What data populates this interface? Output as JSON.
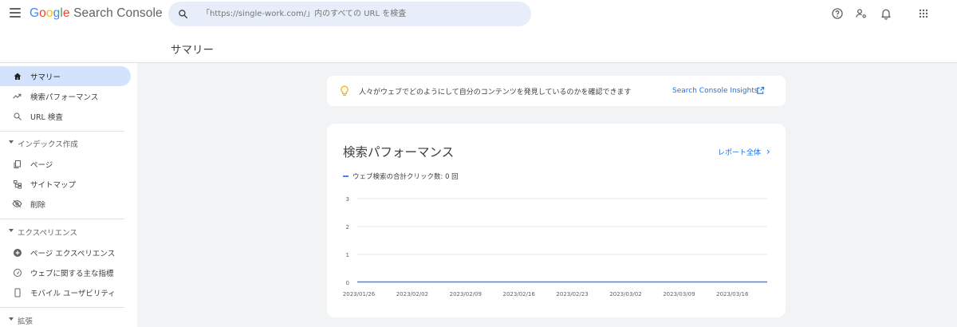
{
  "header": {
    "logo": {
      "g": "G",
      "o1": "o",
      "o2": "o",
      "g2": "g",
      "l": "l",
      "e": "e",
      "product": "Search Console"
    },
    "search_placeholder": "「https://single-work.com/」内のすべての URL を検査",
    "icons": [
      "menu-icon",
      "search-icon",
      "help-icon",
      "manage-users-icon",
      "notifications-icon",
      "apps-icon"
    ]
  },
  "page_title": "サマリー",
  "sidebar": {
    "items": [
      {
        "label": "サマリー",
        "icon": "home-icon",
        "active": true
      },
      {
        "label": "検索パフォーマンス",
        "icon": "trending-icon"
      },
      {
        "label": "URL 検査",
        "icon": "search-icon"
      }
    ],
    "sections": [
      {
        "label": "インデックス作成",
        "items": [
          {
            "label": "ページ",
            "icon": "pages-icon"
          },
          {
            "label": "サイトマップ",
            "icon": "sitemap-icon"
          },
          {
            "label": "削除",
            "icon": "removals-icon"
          }
        ]
      },
      {
        "label": "エクスペリエンス",
        "items": [
          {
            "label": "ページ エクスペリエンス",
            "icon": "page-experience-icon"
          },
          {
            "label": "ウェブに関する主な指標",
            "icon": "speed-icon"
          },
          {
            "label": "モバイル ユーザビリティ",
            "icon": "mobile-icon"
          }
        ]
      },
      {
        "label": "拡張",
        "items": []
      }
    ]
  },
  "insight": {
    "message": "人々がウェブでどのようにして自分のコンテンツを発見しているのかを確認できます",
    "link": "Search Console Insights",
    "icon": "lightbulb-icon"
  },
  "performance": {
    "title": "検索パフォーマンス",
    "report_link": "レポート全体",
    "legend": "ウェブ検索の合計クリック数: 0 回"
  },
  "colors": {
    "accent": "#1a73e8",
    "active_nav": "#d3e3fd",
    "series": "#4285f4"
  },
  "chart_data": {
    "type": "line",
    "x": [
      "2023/01/26",
      "2023/02/02",
      "2023/02/09",
      "2023/02/16",
      "2023/02/23",
      "2023/03/02",
      "2023/03/09",
      "2023/03/16"
    ],
    "series": [
      {
        "values": [
          0,
          0,
          0,
          0,
          0,
          0,
          0,
          0
        ]
      }
    ],
    "yticks": [
      "3",
      "2",
      "1",
      "0"
    ],
    "ylim": [
      0,
      3
    ],
    "grid": true
  }
}
